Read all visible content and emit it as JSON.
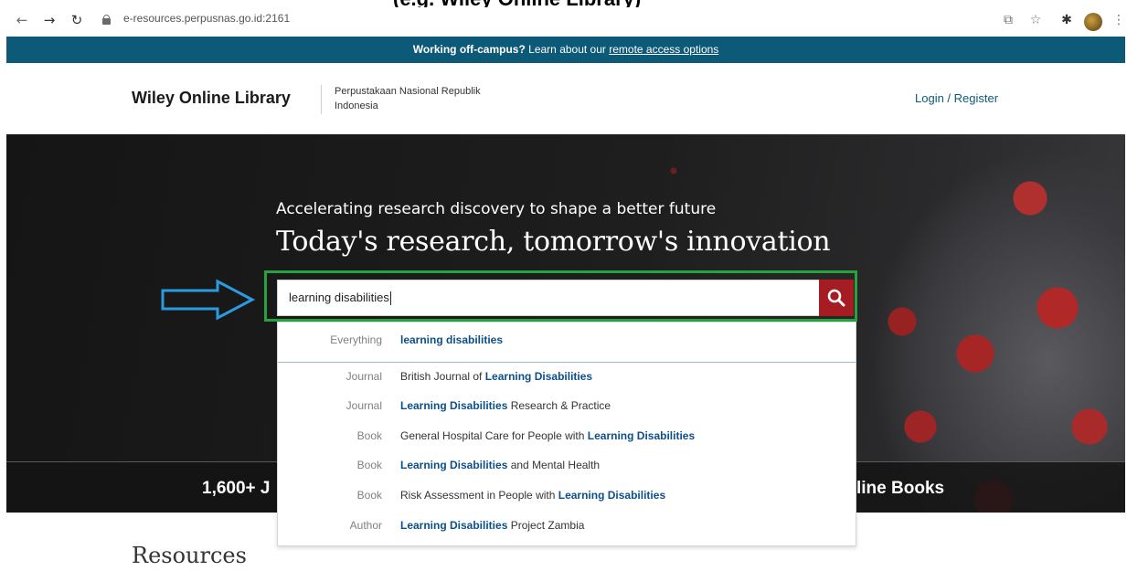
{
  "caption": "(e.g. Wiley Online Library)",
  "browser": {
    "url": "e-resources.perpusnas.go.id:2161",
    "icons": [
      "back-icon",
      "forward-icon",
      "reload-icon",
      "lock-icon",
      "share-icon",
      "star-icon",
      "extensions-icon",
      "profile-icon",
      "menu-icon"
    ]
  },
  "banner": {
    "lead": "Working off-campus?",
    "middle": " Learn about our ",
    "link": "remote access options"
  },
  "header": {
    "logo": "Wiley Online Library",
    "institution": "Perpustakaan Nasional Republik Indonesia",
    "login": "Login / Register"
  },
  "hero": {
    "subtitle": "Accelerating research discovery to shape a better future",
    "title": "Today's research, tomorrow's innovation",
    "stat_left": "1,600+ J",
    "stat_right": "line Books"
  },
  "search": {
    "value": "learning disabilities",
    "button_color": "#a51d22",
    "highlight_color": "#26a33c",
    "arrow_color": "#2b9be0"
  },
  "suggestions": [
    {
      "type": "Everything",
      "before": "",
      "match": "learning disabilities",
      "after": ""
    },
    {
      "type": "Journal",
      "before": "British Journal of ",
      "match": "Learning Disabilities",
      "after": ""
    },
    {
      "type": "Journal",
      "before": "",
      "match": "Learning Disabilities",
      "after": " Research & Practice"
    },
    {
      "type": "Book",
      "before": "General Hospital Care for People with ",
      "match": "Learning Disabilities",
      "after": ""
    },
    {
      "type": "Book",
      "before": "",
      "match": "Learning Disabilities",
      "after": " and Mental Health"
    },
    {
      "type": "Book",
      "before": "Risk Assessment in People with ",
      "match": "Learning Disabilities",
      "after": ""
    },
    {
      "type": "Author",
      "before": "",
      "match": "Learning Disabilities",
      "after": " Project Zambia"
    }
  ],
  "resources_heading": "Resources"
}
